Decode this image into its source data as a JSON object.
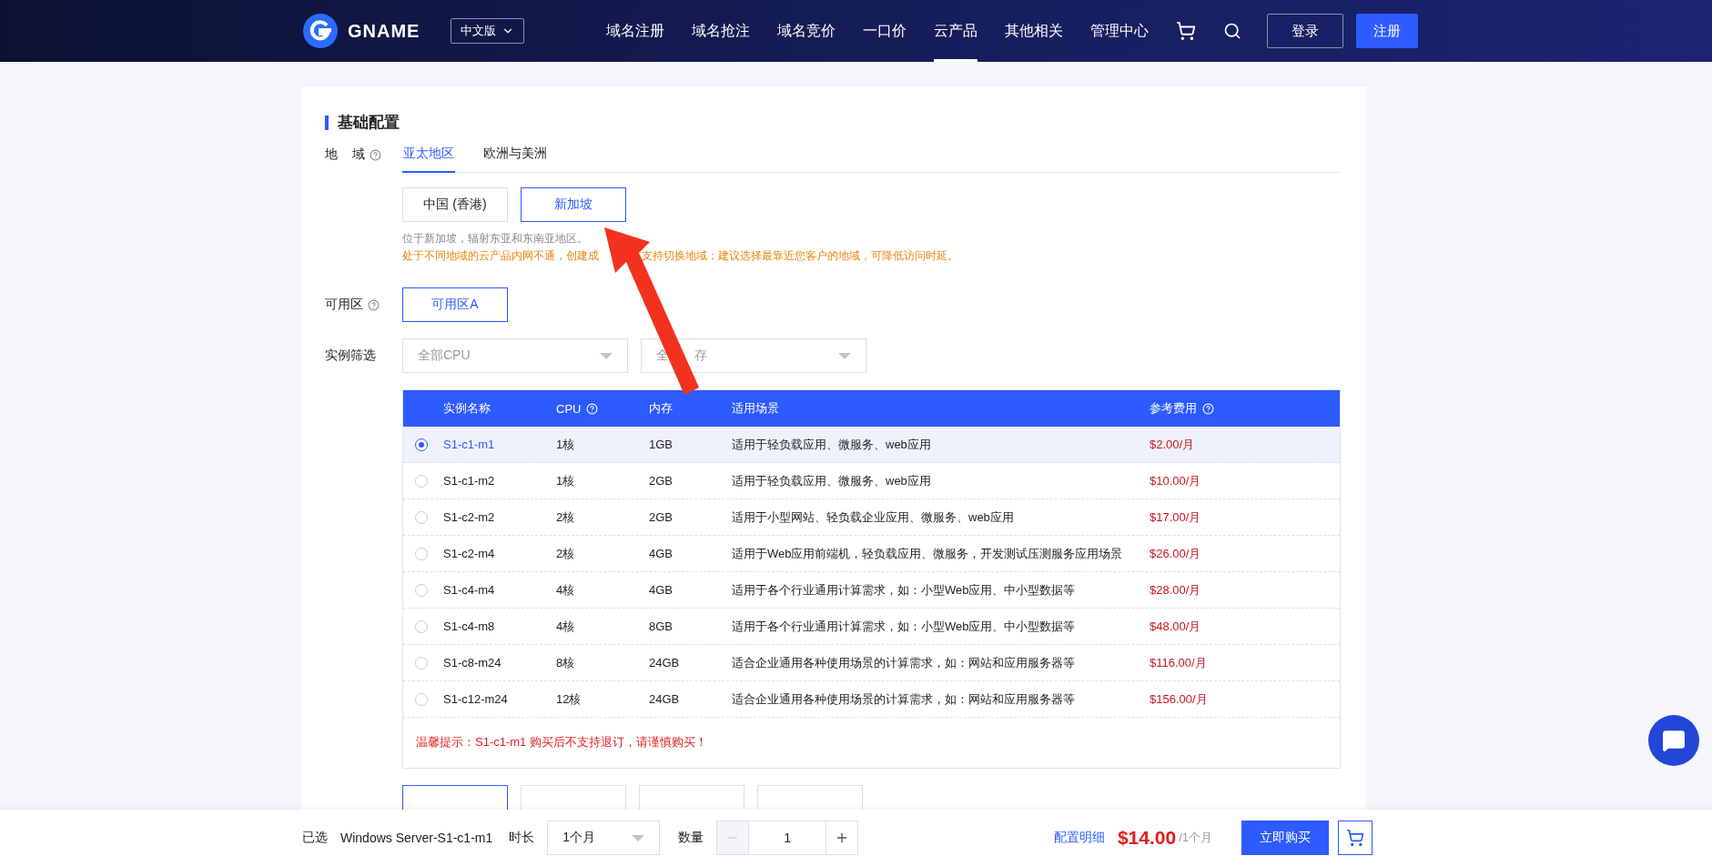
{
  "header": {
    "logo_text": "GNAME",
    "language": "中文版",
    "nav": [
      {
        "label": "域名注册",
        "selected": false
      },
      {
        "label": "域名抢注",
        "selected": false
      },
      {
        "label": "域名竞价",
        "selected": false
      },
      {
        "label": "一口价",
        "selected": false
      },
      {
        "label": "云产品",
        "selected": true
      },
      {
        "label": "其他相关",
        "selected": false
      },
      {
        "label": "管理中心",
        "selected": false
      }
    ],
    "login": "登录",
    "register": "注册"
  },
  "config": {
    "section_title": "基础配置",
    "region": {
      "label": "地 域",
      "help": true,
      "tabs": [
        {
          "label": "亚太地区",
          "selected": true
        },
        {
          "label": "欧洲与美洲",
          "selected": false
        }
      ],
      "options": [
        {
          "label": "中国 (香港)",
          "selected": false
        },
        {
          "label": "新加坡",
          "selected": true
        }
      ],
      "note": "位于新加坡，辐射东亚和东南亚地区。",
      "warning_parts": [
        "处于不同地域的云产品内网不通，创建成",
        "支持切换地域；建议选择最靠近您客户的地域，可降低访问时延。"
      ]
    },
    "zone": {
      "label": "可用区",
      "help": true,
      "options": [
        {
          "label": "可用区A",
          "selected": true
        }
      ]
    },
    "filter": {
      "label": "实例筛选",
      "selects": [
        {
          "placeholder_parts": [
            "全部CPU"
          ]
        },
        {
          "placeholder_parts": [
            "全",
            "存"
          ]
        }
      ]
    },
    "table": {
      "columns": [
        {
          "label": "实例名称",
          "help": false
        },
        {
          "label": "CPU",
          "help": true
        },
        {
          "label": "内存",
          "help": false
        },
        {
          "label": "适用场景",
          "help": false
        },
        {
          "label": "参考费用",
          "help": true
        }
      ],
      "rows": [
        {
          "selected": true,
          "name": "S1-c1-m1",
          "cpu": "1核",
          "memory": "1GB",
          "scenario": "适用于轻负载应用、微服务、web应用",
          "price": "$2.00/月"
        },
        {
          "selected": false,
          "name": "S1-c1-m2",
          "cpu": "1核",
          "memory": "2GB",
          "scenario": "适用于轻负载应用、微服务、web应用",
          "price": "$10.00/月"
        },
        {
          "selected": false,
          "name": "S1-c2-m2",
          "cpu": "2核",
          "memory": "2GB",
          "scenario": "适用于小型网站、轻负载企业应用、微服务、web应用",
          "price": "$17.00/月"
        },
        {
          "selected": false,
          "name": "S1-c2-m4",
          "cpu": "2核",
          "memory": "4GB",
          "scenario": "适用于Web应用前端机，轻负载应用、微服务，开发测试压测服务应用场景",
          "price": "$26.00/月"
        },
        {
          "selected": false,
          "name": "S1-c4-m4",
          "cpu": "4核",
          "memory": "4GB",
          "scenario": "适用于各个行业通用计算需求，如：小型Web应用、中小型数据等",
          "price": "$28.00/月"
        },
        {
          "selected": false,
          "name": "S1-c4-m8",
          "cpu": "4核",
          "memory": "8GB",
          "scenario": "适用于各个行业通用计算需求，如：小型Web应用、中小型数据等",
          "price": "$48.00/月"
        },
        {
          "selected": false,
          "name": "S1-c8-m24",
          "cpu": "8核",
          "memory": "24GB",
          "scenario": "适合企业通用各种使用场景的计算需求，如：网站和应用服务器等",
          "price": "$116.00/月"
        },
        {
          "selected": false,
          "name": "S1-c12-m24",
          "cpu": "12核",
          "memory": "24GB",
          "scenario": "适合企业通用各种使用场景的计算需求，如：网站和应用服务器等",
          "price": "$156.00/月"
        }
      ],
      "notice": "温馨提示：S1-c1-m1 购买后不支持退订，请谨慎购买！"
    },
    "os_options": [
      {
        "selected": true
      },
      {
        "selected": false
      },
      {
        "selected": false
      },
      {
        "selected": false
      }
    ]
  },
  "bottom_bar": {
    "selected_label": "已选",
    "selected_value": "Windows Server-S1-c1-m1",
    "duration_label": "时长",
    "duration": "1个月",
    "quantity_label": "数量",
    "quantity": "1",
    "minus_disabled": true,
    "details_link": "配置明细",
    "price": "$14.00",
    "price_unit": "/1个月",
    "buy": "立即购买"
  }
}
